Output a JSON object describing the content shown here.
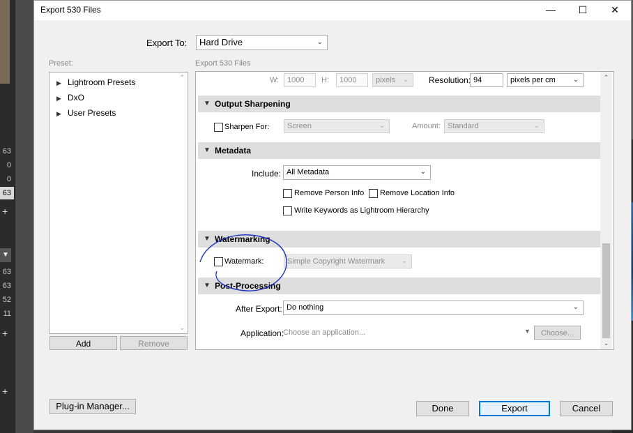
{
  "background": {
    "numbers": [
      "63",
      "0",
      "0",
      "63",
      "63",
      "63",
      "52",
      "11"
    ]
  },
  "dialog": {
    "title": "Export 530 Files",
    "window_controls": {
      "minimize": "—",
      "maximize": "☐",
      "close": "✕"
    },
    "export_to_label": "Export To:",
    "export_to_value": "Hard Drive",
    "preset_label": "Preset:",
    "presets": [
      {
        "label": "Lightroom Presets"
      },
      {
        "label": "DxO"
      },
      {
        "label": "User Presets"
      }
    ],
    "add_label": "Add",
    "remove_label": "Remove",
    "export_files_label": "Export 530 Files",
    "plugin_manager_label": "Plug-in Manager...",
    "done_label": "Done",
    "export_label": "Export",
    "cancel_label": "Cancel"
  },
  "image_sizing": {
    "w_label": "W:",
    "w_value": "1000",
    "h_label": "H:",
    "h_value": "1000",
    "units": "pixels",
    "resolution_label": "Resolution:",
    "resolution_value": "94",
    "resolution_units": "pixels per cm"
  },
  "output_sharpening": {
    "header": "Output Sharpening",
    "sharpen_for_label": "Sharpen For:",
    "sharpen_for_value": "Screen",
    "amount_label": "Amount:",
    "amount_value": "Standard"
  },
  "metadata": {
    "header": "Metadata",
    "include_label": "Include:",
    "include_value": "All Metadata",
    "remove_person_info": "Remove Person Info",
    "remove_location_info": "Remove Location Info",
    "write_keywords": "Write Keywords as Lightroom Hierarchy"
  },
  "watermarking": {
    "header": "Watermarking",
    "watermark_label": "Watermark:",
    "watermark_value": "Simple Copyright Watermark"
  },
  "post_processing": {
    "header": "Post-Processing",
    "after_export_label": "After Export:",
    "after_export_value": "Do nothing",
    "application_label": "Application:",
    "application_placeholder": "Choose an application...",
    "choose_label": "Choose..."
  },
  "colors": {
    "annotation_circle": "#1f2fbf",
    "accent": "#0078d7"
  }
}
